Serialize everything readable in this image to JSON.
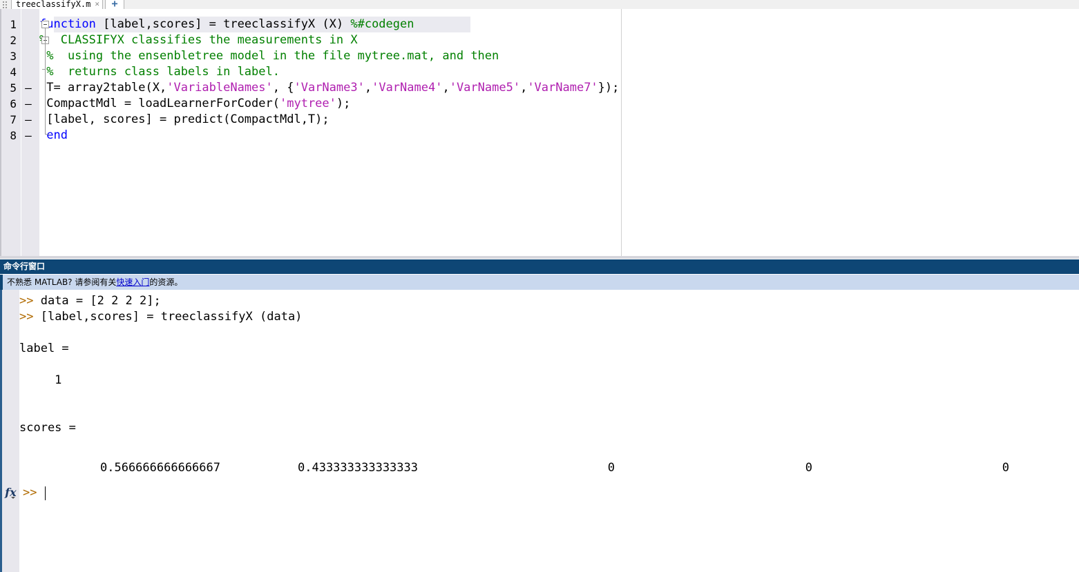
{
  "editor": {
    "tab": {
      "label": "treeclassifyX.m",
      "close_icon": "close-icon",
      "close_glyph": "✕",
      "new_tab_glyph": "+"
    },
    "line_numbers": [
      "1",
      "2",
      "3",
      "4",
      "5",
      "6",
      "7",
      "8"
    ],
    "executable_dash": "–",
    "lines": [
      {
        "num": "1",
        "dash": "",
        "current": true,
        "tokens": [
          {
            "t": "function ",
            "c": "kw"
          },
          {
            "t": "[label,scores] = treeclassifyX (X) ",
            "c": "plain"
          },
          {
            "t": "%#codegen",
            "c": "pragma"
          }
        ]
      },
      {
        "num": "2",
        "dash": "",
        "current": false,
        "tokens": [
          {
            "t": "%  CLASSIFYX classifies the measurements in X",
            "c": "comment"
          }
        ]
      },
      {
        "num": "3",
        "dash": "",
        "current": false,
        "tokens": [
          {
            "t": " %  using the ensenbletree model in the file mytree.mat, and then",
            "c": "comment"
          }
        ]
      },
      {
        "num": "4",
        "dash": "",
        "current": false,
        "tokens": [
          {
            "t": " %  returns class labels in label.",
            "c": "comment"
          }
        ]
      },
      {
        "num": "5",
        "dash": "–",
        "current": false,
        "tokens": [
          {
            "t": " T= array2table(X,",
            "c": "plain"
          },
          {
            "t": "'VariableNames'",
            "c": "str"
          },
          {
            "t": ", {",
            "c": "plain"
          },
          {
            "t": "'VarName3'",
            "c": "str"
          },
          {
            "t": ",",
            "c": "plain"
          },
          {
            "t": "'VarName4'",
            "c": "str"
          },
          {
            "t": ",",
            "c": "plain"
          },
          {
            "t": "'VarName5'",
            "c": "str"
          },
          {
            "t": ",",
            "c": "plain"
          },
          {
            "t": "'VarName7'",
            "c": "str"
          },
          {
            "t": "});",
            "c": "plain"
          }
        ]
      },
      {
        "num": "6",
        "dash": "–",
        "current": false,
        "tokens": [
          {
            "t": " CompactMdl = loadLearnerForCoder(",
            "c": "plain"
          },
          {
            "t": "'mytree'",
            "c": "str"
          },
          {
            "t": ");",
            "c": "plain"
          }
        ]
      },
      {
        "num": "7",
        "dash": "–",
        "current": false,
        "tokens": [
          {
            "t": " [label, scores] = predict(CompactMdl,T);",
            "c": "plain"
          }
        ]
      },
      {
        "num": "8",
        "dash": "–",
        "current": false,
        "tokens": [
          {
            "t": " ",
            "c": "plain"
          },
          {
            "t": "end",
            "c": "kw"
          }
        ]
      }
    ]
  },
  "command_window": {
    "title": "命令行窗口",
    "info_prefix": "不熟悉 MATLAB? 请参阅有关",
    "info_link": "快速入门",
    "info_suffix": "的资源。",
    "output_lines": [
      {
        "prompt": ">> ",
        "text": "data = [2 2 2 2];"
      },
      {
        "prompt": ">> ",
        "text": "[label,scores] = treeclassifyX (data)"
      },
      {
        "prompt": "",
        "text": ""
      },
      {
        "prompt": "",
        "text": "label ="
      },
      {
        "prompt": "",
        "text": ""
      },
      {
        "prompt": "",
        "text": "     1"
      },
      {
        "prompt": "",
        "text": ""
      },
      {
        "prompt": "",
        "text": ""
      },
      {
        "prompt": "",
        "text": "scores ="
      },
      {
        "prompt": "",
        "text": ""
      }
    ],
    "scores_row": [
      "0.566666666666667",
      "0.433333333333333",
      "0",
      "0",
      "0"
    ],
    "prompt": {
      "fx_label": "fx",
      "symbol": ">>",
      "input_value": ""
    }
  },
  "colors": {
    "keyword": "#0000ff",
    "comment": "#028000",
    "string": "#b020b0",
    "titlebar": "#0e4675",
    "infobar": "#c9d8ee",
    "link": "#0000cc",
    "prompt": "#b06a00",
    "gutter": "#e8e7ed"
  }
}
